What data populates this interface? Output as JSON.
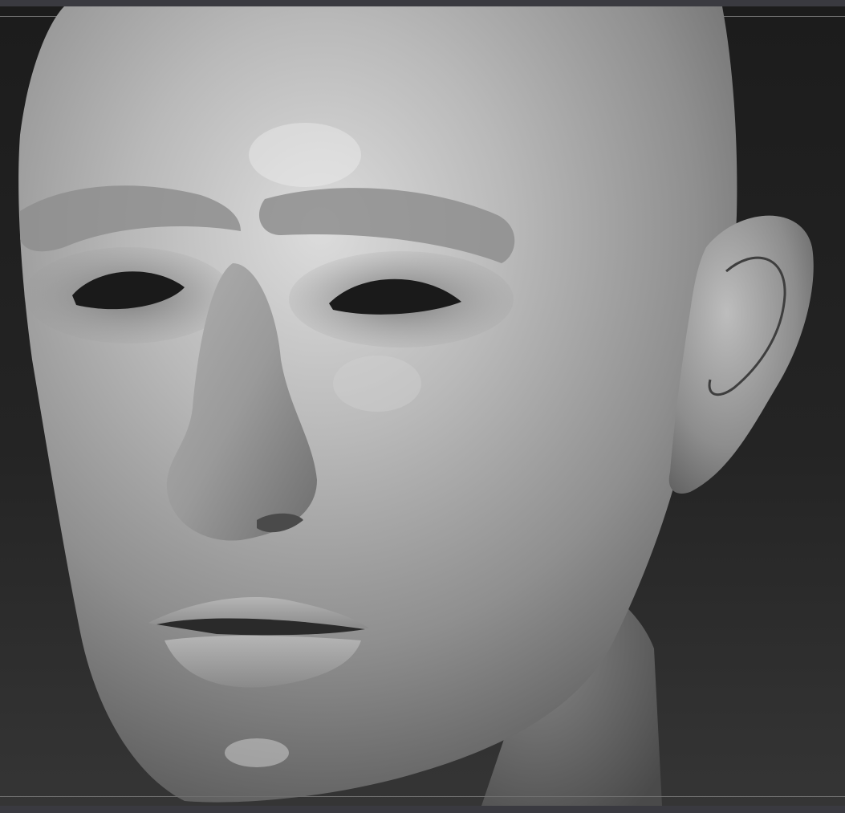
{
  "app": {
    "colors": {
      "chrome": "#3a3a40",
      "viewport_top": "#1c1c1c",
      "viewport_bottom": "#353535",
      "clay": "#a8a8a8"
    }
  },
  "viewport": {
    "content": "sculpted-head-model"
  }
}
